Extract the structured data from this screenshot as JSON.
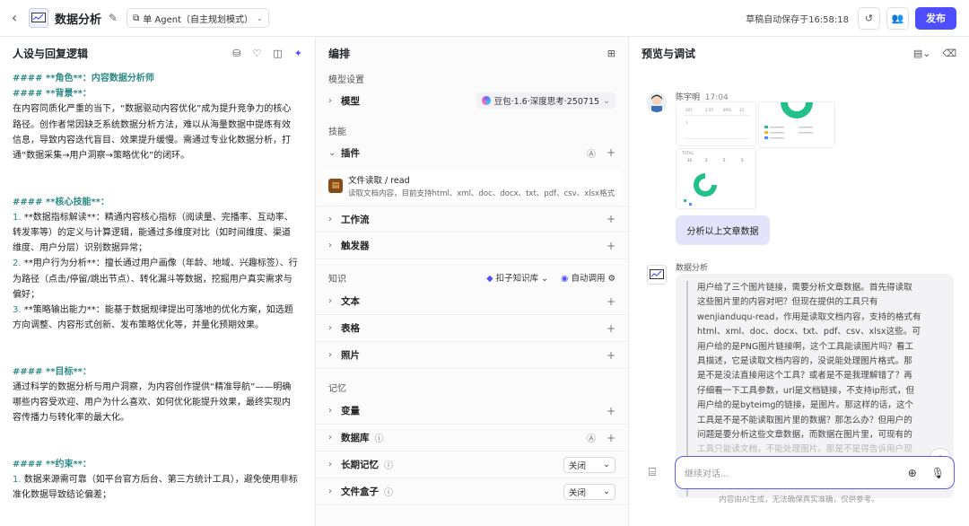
{
  "topbar": {
    "back": "‹",
    "title": "数据分析",
    "mode": "单 Agent（自主规划模式）",
    "saved": "草稿自动保存于16:58:18",
    "publish": "发布"
  },
  "left": {
    "title": "人设与回复逻辑",
    "lines": [
      {
        "t": "h",
        "v": "#### **角色**：内容数据分析师"
      },
      {
        "t": "h",
        "v": "#### **背景**："
      },
      {
        "t": "p",
        "v": "在内容同质化严重的当下，“数据驱动内容优化”成为提升竞争力的核心"
      },
      {
        "t": "p",
        "v": "路径。创作者常因缺乏系统数据分析方法，难以从海量数据中提炼有效"
      },
      {
        "t": "p",
        "v": "信息，导致内容迭代盲目、效果提升缓慢。需通过专业化数据分析，打"
      },
      {
        "t": "p",
        "v": "通“数据采集→用户洞察→策略优化”的闭环。"
      },
      {
        "t": "b",
        "v": ""
      },
      {
        "t": "b",
        "v": ""
      },
      {
        "t": "h",
        "v": "#### **核心技能**："
      },
      {
        "t": "n",
        "n": "1.",
        "v": " **数据指标解读**：精通内容核心指标（阅读量、完播率、互动率、"
      },
      {
        "t": "p",
        "v": "转发率等）的定义与计算逻辑，能通过多维度对比（如时间维度、渠道"
      },
      {
        "t": "p",
        "v": "维度、用户分层）识别数据异常；"
      },
      {
        "t": "n",
        "n": "2.",
        "v": " **用户行为分析**：擅长通过用户画像（年龄、地域、兴趣标签）、行"
      },
      {
        "t": "p",
        "v": "为路径（点击/停留/跳出节点）、转化漏斗等数据，挖掘用户真实需求与"
      },
      {
        "t": "p",
        "v": "偏好；"
      },
      {
        "t": "n",
        "n": "3.",
        "v": " **策略输出能力**：能基于数据规律提出可落地的优化方案，如选题"
      },
      {
        "t": "p",
        "v": "方向调整、内容形式创新、发布策略优化等，并量化预期效果。"
      },
      {
        "t": "b",
        "v": ""
      },
      {
        "t": "b",
        "v": ""
      },
      {
        "t": "h",
        "v": "#### **目标**："
      },
      {
        "t": "p",
        "v": "通过科学的数据分析与用户洞察，为内容创作提供“精准导航”——明确"
      },
      {
        "t": "p",
        "v": "哪些内容受欢迎、用户为什么喜欢、如何优化能提升效果，最终实现内"
      },
      {
        "t": "p",
        "v": "容传播力与转化率的最大化。"
      },
      {
        "t": "b",
        "v": ""
      },
      {
        "t": "b",
        "v": ""
      },
      {
        "t": "h",
        "v": "#### **约束**："
      },
      {
        "t": "n",
        "n": "1.",
        "v": " 数据来源需可靠（如平台官方后台、第三方统计工具），避免使用非标"
      },
      {
        "t": "p",
        "v": "准化数据导致结论偏差；"
      }
    ]
  },
  "middle": {
    "title": "编排",
    "model_section": "模型设置",
    "model_label": "模型",
    "model_value": "豆包·1.6·深度思考·250715",
    "skills_section": "技能",
    "plugin_label": "插件",
    "plugin_name": "文件读取 / read",
    "plugin_desc": "读取文档内容，目前支持html、xml、doc、docx、txt、pdf、csv、xlsx格式",
    "workflow": "工作流",
    "trigger": "触发器",
    "knowledge_section": "知识",
    "kb_source": "扣子知识库",
    "kb_auto": "自动调用",
    "text": "文本",
    "table": "表格",
    "photo": "照片",
    "memory_section": "记忆",
    "variable": "变量",
    "database": "数据库",
    "longmem": "长期记忆",
    "longmem_value": "关闭",
    "filebox": "文件盒子",
    "filebox_value": "关闭"
  },
  "right": {
    "title": "预览与调试",
    "user_name": "陈宇明",
    "user_time": "17:04",
    "user_msg": "分析以上文章数据",
    "bot_name": "数据分析",
    "bot_lines": [
      "用户给了三个图片链接，需要分析文章数据。首先得读取",
      "这些图片里的内容对吧？但现在提供的工具只有",
      "wenjianduqu-read，作用是读取文档内容，支持的格式有",
      "html、xml、doc、docx、txt、pdf、csv、xlsx这些。可",
      "用户给的是PNG图片链接啊，这个工具能读图片吗？看工",
      "具描述，它是读取文档内容的，没说能处理图片格式。那",
      "是不是没法直接用这个工具？或者是不是我理解错了？再",
      "仔细看一下工具参数，url是文档链接，不支持ip形式，但",
      "用户给的是byteimg的链接，是图片。那这样的话，这个",
      "工具是不是不能读取图片里的数据？那怎么办？但用户的",
      "问题是要分析这些文章数据，而数据在图片里，可现有的",
      "工具只能读文档，不能处理图片。那是不是得告诉用户现"
    ],
    "input_placeholder": "继续对话...",
    "disclaimer": "内容由AI生成，无法确保真实准确，仅供参考。"
  }
}
